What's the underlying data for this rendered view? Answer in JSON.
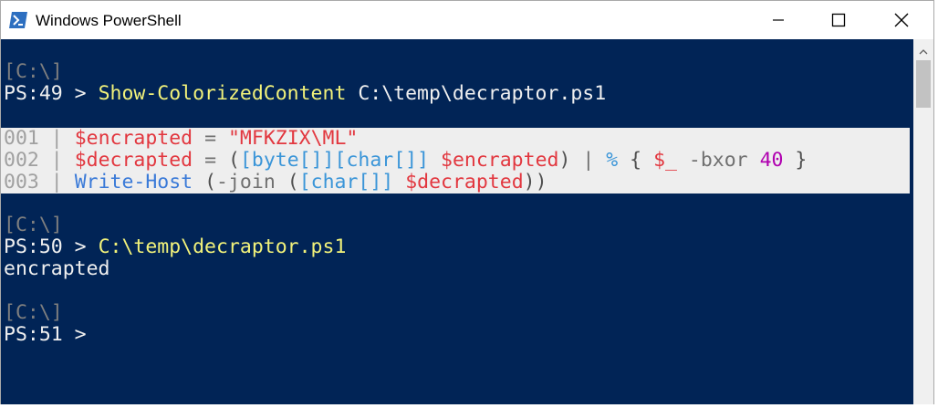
{
  "window": {
    "title": "Windows PowerShell",
    "accent_color": "#012456",
    "app_icon": "powershell-icon"
  },
  "controls": {
    "minimize": "minimize-icon",
    "maximize": "maximize-icon",
    "close": "close-icon"
  },
  "console": {
    "block1": {
      "path": "[C:\\]",
      "prompt": "PS:49 > ",
      "command": "Show-ColorizedContent",
      "arg": " C:\\temp\\decraptor.ps1"
    },
    "code": [
      {
        "num": "001",
        "sep": " | ",
        "parts": {
          "v": "$encrapted",
          "eq": " = ",
          "s": "\"MFKZIX\\ML\""
        }
      },
      {
        "num": "002",
        "sep": " | ",
        "parts": {
          "v": "$decrapted",
          "eq": " = ",
          "p1": "(",
          "t1": "[byte[]]",
          "t2": "[char[]]",
          "sp": " ",
          "v2": "$encrapted",
          "p2": ") ",
          "pipe": "|",
          "sp2": " ",
          "pct": "%",
          "b1": " { ",
          "v3": "$_",
          "op": " -bxor ",
          "n": "40",
          "b2": " }"
        }
      },
      {
        "num": "003",
        "sep": " | ",
        "parts": {
          "cmd": "Write-Host",
          "sp": " ",
          "p1": "(",
          "join": "-join",
          "sp2": " ",
          "p2": "(",
          "t": "[char[]]",
          "sp3": " ",
          "v": "$decrapted",
          "p3": "))"
        }
      }
    ],
    "block2": {
      "path": "[C:\\]",
      "prompt": "PS:50 > ",
      "command": "C:\\temp\\decraptor.ps1",
      "output": "encrapted"
    },
    "block3": {
      "path": "[C:\\]",
      "prompt": "PS:51 > "
    }
  }
}
